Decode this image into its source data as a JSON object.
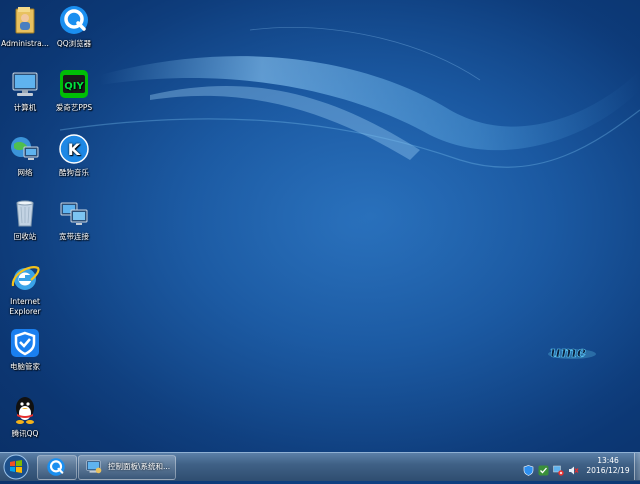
{
  "desktop": {
    "icons": [
      {
        "label": "Administra...",
        "icon": "user-folder-icon"
      },
      {
        "label": "QQ浏览器",
        "icon": "qq-browser-icon"
      },
      {
        "label": "计算机",
        "icon": "computer-icon"
      },
      {
        "label": "爱奇艺PPS",
        "icon": "iqiyi-icon"
      },
      {
        "label": "网络",
        "icon": "network-icon"
      },
      {
        "label": "酷狗音乐",
        "icon": "kugou-icon"
      },
      {
        "label": "回收站",
        "icon": "recycle-bin-icon"
      },
      {
        "label": "宽带连接",
        "icon": "broadband-icon"
      },
      {
        "label": "Internet Explorer",
        "icon": "internet-explorer-icon"
      },
      {
        "label": "电脑管家",
        "icon": "pc-manager-icon"
      },
      {
        "label": "腾讯QQ",
        "icon": "qq-penguin-icon"
      }
    ],
    "watermark": "ume"
  },
  "taskbar": {
    "start": {
      "icon": "windows-start-icon"
    },
    "pinned": [
      {
        "icon": "qq-browser-icon"
      }
    ],
    "windows": [
      {
        "label": "控制面板\\系统和...",
        "icon": "control-panel-icon"
      }
    ],
    "tray": [
      {
        "icon": "shield-tray-icon"
      },
      {
        "icon": "security-check-icon"
      },
      {
        "icon": "network-warning-icon"
      },
      {
        "icon": "volume-muted-icon"
      }
    ],
    "clock": {
      "time": "13:46",
      "date": "2016/12/19"
    }
  },
  "colors": {
    "wallpaper": "#144f97",
    "taskbar": "#3f6186"
  }
}
